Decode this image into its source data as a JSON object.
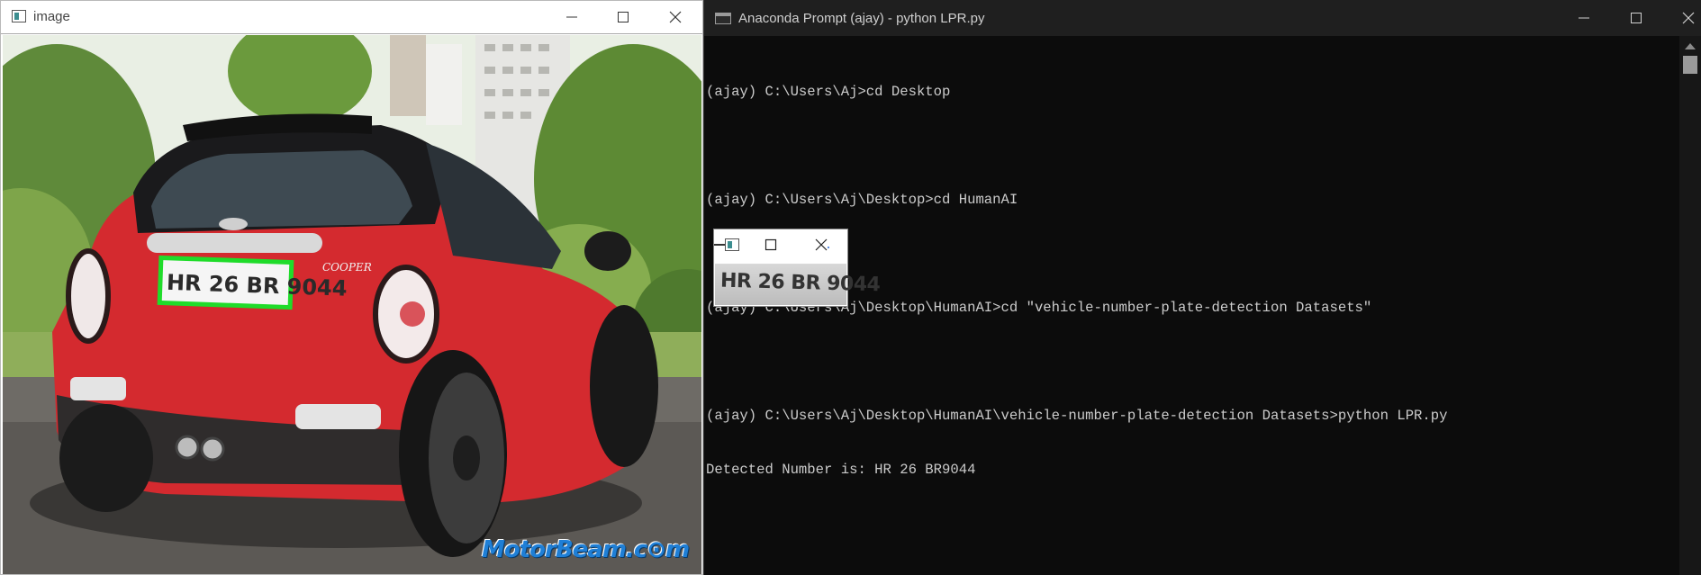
{
  "image_window": {
    "title": "image",
    "controls": [
      "minimize",
      "maximize",
      "close"
    ],
    "plate_text": "HR 26 BR 9044",
    "badge_text": "COOPER",
    "watermark": "MotorBeam.c⊙m",
    "detection_box_color": "#1fdc2a"
  },
  "terminal": {
    "title": "Anaconda Prompt (ajay) - python  LPR.py",
    "lines": [
      "(ajay) C:\\Users\\Aj>cd Desktop",
      "",
      "(ajay) C:\\Users\\Aj\\Desktop>cd HumanAI",
      "",
      "(ajay) C:\\Users\\Aj\\Desktop\\HumanAI>cd \"vehicle-number-plate-detection Datasets\"",
      "",
      "(ajay) C:\\Users\\Aj\\Desktop\\HumanAI\\vehicle-number-plate-detection Datasets>python LPR.py",
      "Detected Number is: HR 26 BR9044"
    ]
  },
  "crop_window": {
    "plate_text": "HR 26 BR 9044"
  },
  "colors": {
    "terminal_bg": "#0c0c0c",
    "terminal_text": "#cccccc",
    "car_red": "#d42a2f"
  }
}
